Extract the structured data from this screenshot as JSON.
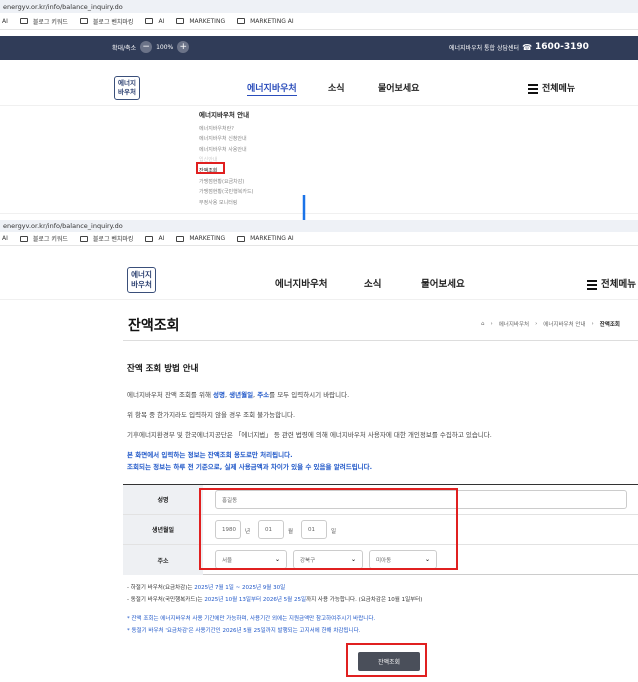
{
  "top_screenshot": {
    "url": "energyv.or.kr/info/balance_inquiry.do",
    "bookmarks": [
      "AI",
      "블로그 키워드",
      "블로그 벤치마킹",
      "AI",
      "MARKETING",
      "MARKETING AI"
    ],
    "topbar": {
      "zoom_label": "확대/축소",
      "zoom_out": "−",
      "zoom_level": "100%",
      "zoom_in": "+",
      "center_label": "에너지바우처 통합 상담센터",
      "phone_icon": "☎",
      "phone": "1600-3190"
    },
    "logo": [
      "에너지",
      "바우처"
    ],
    "nav": [
      "에너지바우처",
      "소식",
      "물어보세요"
    ],
    "all_menu": "전체메뉴",
    "dropdown": {
      "heading": "에너지바우처 안내",
      "items": [
        "에너지바우처란?",
        "에너지바우처 신청안내",
        "에너지바우처 사용안내",
        "잔액조회",
        "가맹점현황(요금차감)",
        "가맹점현황(국민행복카드)",
        "부정사용 모니터링"
      ],
      "hidden_item": "입신안내",
      "highlight_item": "잔액조회"
    }
  },
  "arrow": {
    "color": "#1a73e8"
  },
  "bottom_screenshot": {
    "url": "energyv.or.kr/info/balance_inquiry.do",
    "bookmarks": [
      "AI",
      "블로그 키워드",
      "블로그 벤치마킹",
      "AI",
      "MARKETING",
      "MARKETING AI"
    ],
    "logo": [
      "에너지",
      "바우처"
    ],
    "nav": [
      "에너지바우처",
      "소식",
      "물어보세요"
    ],
    "all_menu": "전체메뉴",
    "page_title": "잔액조회",
    "breadcrumb": [
      "에너지바우처",
      "에너지바우처 안내",
      "잔액조회"
    ],
    "section_title": "잔액 조회 방법 안내",
    "p1_prefix": "에너지바우처 잔액 조회를 위해 ",
    "p1_fields": [
      "성명",
      "생년월일",
      "주소"
    ],
    "p1_suffix": "를 모두 입력하시기 바랍니다.",
    "p1_sep": ", ",
    "p2": "위 항목 중 한가지라도 입력하지 않을 경우 조회 불가능합니다.",
    "p3": "기후에너지환경부 및 한국에너지공단은 「에너지법」 등 관련 법령에 의해 에너지바우처 사용자에 대한 개인정보를 수집하고 있습니다.",
    "notice1": "본 화면에서 입력하는 정보는 잔액조회 용도로만 처리됩니다.",
    "notice2": "조회되는 정보는 하루 전 기준으로, 실제 사용금액과 차이가 있을 수 있음을 알려드립니다.",
    "form": {
      "name_label": "성명",
      "name_value": "홍길동",
      "birth_label": "생년월일",
      "birth_year": "1980",
      "year_unit": "년",
      "birth_month": "01",
      "month_unit": "월",
      "birth_day": "01",
      "day_unit": "일",
      "address_label": "주소",
      "sido": "서울",
      "gu": "강북구",
      "dong": "미아동"
    },
    "info_summer_prefix": "- 하절기 바우처(요금차감)는 ",
    "info_summer_date": "2025년 7월 1일 ~ 2025년 9월 30일",
    "info_winter_prefix": "- 동절기 바우처(국민행복카드)는 ",
    "info_winter_date": "2025년 10월 13일부터 2026년 5월 25일",
    "info_winter_suffix": "까지 사용 가능합니다. (요금차감은 10월 1일부터)",
    "bnote1": "* 잔액 조회는 에너지바우처 사용 기간에만 가능하며, 사용기간 외에는 지원금액만 참고하여주시기 바랍니다.",
    "bnote2": "* 동절기 바우처 '요금차감'은 사용기간인 2026년 5월 25일까지 발행되는 고지서에 한해 차감됩니다.",
    "submit": "잔액조회"
  },
  "colors": {
    "topbar": "#303c58",
    "highlight": "#e02020",
    "accent_blue": "#1f57c8",
    "button": "#4a4f5a"
  }
}
